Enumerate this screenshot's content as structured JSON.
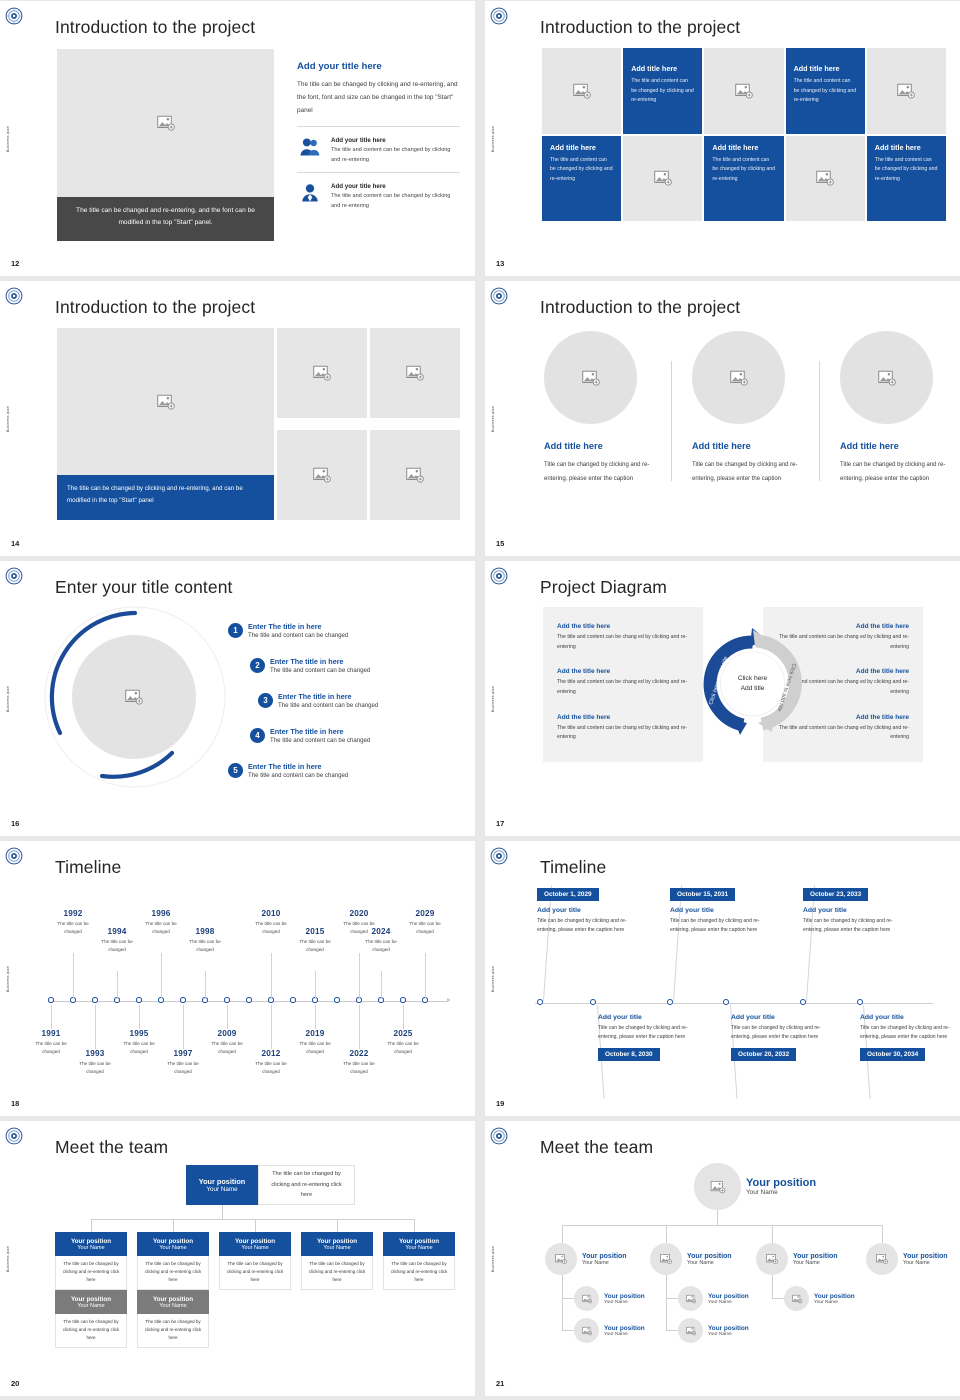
{
  "brand": {
    "accent": "#14509e",
    "dark_caption": "#484848",
    "gray_box": "#e6e6e6",
    "gray_node": "#7b7b7b"
  },
  "sidebar_label": "Business plan",
  "logo_icon": "circular-emblem-logo",
  "slides": [
    {
      "number": "12",
      "title": "Introduction to the project",
      "image_caption": "The title can be changed and re-entering, and the font can be modified in the top \"Start\" panel.",
      "heading": "Add your title here",
      "paragraph": "The title can be changed by clicking and re-entering, and the font, font and size can be changed in the top \"Start\" panel",
      "features": [
        {
          "icon": "people-group-icon",
          "title": "Add your title here",
          "text": "The title and content can be changed by clicking and re-entering"
        },
        {
          "icon": "person-single-icon",
          "title": "Add your title here",
          "text": "The title and content can be changed by clicking and re-entering"
        }
      ]
    },
    {
      "number": "13",
      "title": "Introduction to the project",
      "cells": [
        {
          "type": "image",
          "icon": "image-placeholder-icon"
        },
        {
          "type": "text",
          "title": "Add title here",
          "text": "The title and content can be changed by clicking and re-entering"
        },
        {
          "type": "image",
          "icon": "image-placeholder-icon"
        },
        {
          "type": "text",
          "title": "Add title here",
          "text": "The title and content can be changed by clicking and re-entering"
        },
        {
          "type": "image",
          "icon": "image-placeholder-icon"
        },
        {
          "type": "text",
          "title": "Add title here",
          "text": "The title and content can be changed by clicking and re-entering"
        },
        {
          "type": "image",
          "icon": "image-placeholder-icon"
        },
        {
          "type": "text",
          "title": "Add title here",
          "text": "The title and content can be changed by clicking and re-entering"
        },
        {
          "type": "image",
          "icon": "image-placeholder-icon"
        },
        {
          "type": "text",
          "title": "Add title here",
          "text": "The title and content can be changed by clicking and re-entering"
        }
      ]
    },
    {
      "number": "14",
      "title": "Introduction to the project",
      "image_caption": "The title can be changed by clicking and re-entering, and can be modified in the top \"Start\" panel",
      "quad_icon": "image-placeholder-icon"
    },
    {
      "number": "15",
      "title": "Introduction to the project",
      "columns": [
        {
          "icon": "image-placeholder-icon",
          "title": "Add title here",
          "text": "Title can be changed by clicking and re-entering, please enter the caption"
        },
        {
          "icon": "image-placeholder-icon",
          "title": "Add title here",
          "text": "Title can be changed by clicking and re-entering, please enter the caption"
        },
        {
          "icon": "image-placeholder-icon",
          "title": "Add title here",
          "text": "Title can be changed by clicking and re-entering, please enter the caption"
        }
      ]
    },
    {
      "number": "16",
      "title": "Enter your title content",
      "center_icon": "image-placeholder-icon",
      "items": [
        {
          "num": "1",
          "title": "Enter The title in here",
          "text": "The title and content can be changed"
        },
        {
          "num": "2",
          "title": "Enter The title in here",
          "text": "The title and content can be changed"
        },
        {
          "num": "3",
          "title": "Enter The title in here",
          "text": "The title and content can be changed"
        },
        {
          "num": "4",
          "title": "Enter The title in here",
          "text": "The title and content can be changed"
        },
        {
          "num": "5",
          "title": "Enter The title in here",
          "text": "The title and content can be changed"
        }
      ]
    },
    {
      "number": "17",
      "title": "Project Diagram",
      "hub_line1": "Click here",
      "hub_line2": "Add title",
      "ring_label_left": "Click here to add title",
      "ring_label_right": "Click here to add title",
      "left_items": [
        {
          "title": "Add the title here",
          "text": "The title and content can be chang ed by clicking and re-entering"
        },
        {
          "title": "Add the title here",
          "text": "The title and content can be chang ed by clicking and re-entering"
        },
        {
          "title": "Add the title here",
          "text": "The title and content can be chang ed by clicking and re-entering"
        }
      ],
      "right_items": [
        {
          "title": "Add the title here",
          "text": "The title and content can be chang ed by clicking and re-entering"
        },
        {
          "title": "Add the title here",
          "text": "The title and content can be chang ed by clicking and re-entering"
        },
        {
          "title": "Add the title here",
          "text": "The title and content can be chang ed by clicking and re-entering"
        }
      ]
    },
    {
      "number": "18",
      "title": "Timeline",
      "desc": "The title can be changed",
      "points": [
        {
          "year": "1991",
          "side": "below"
        },
        {
          "year": "1992",
          "side": "above"
        },
        {
          "year": "1993",
          "side": "below"
        },
        {
          "year": "1994",
          "side": "above"
        },
        {
          "year": "1995",
          "side": "below"
        },
        {
          "year": "1996",
          "side": "above"
        },
        {
          "year": "1997",
          "side": "below"
        },
        {
          "year": "1998",
          "side": "above"
        },
        {
          "year": "2009",
          "side": "below"
        },
        {
          "year": "2010",
          "side": "above"
        },
        {
          "year": "2012",
          "side": "below"
        },
        {
          "year": "2015",
          "side": "above"
        },
        {
          "year": "2019",
          "side": "below"
        },
        {
          "year": "2020",
          "side": "above"
        },
        {
          "year": "2022",
          "side": "below"
        },
        {
          "year": "2024",
          "side": "above"
        },
        {
          "year": "2025",
          "side": "below"
        },
        {
          "year": "2029",
          "side": "above"
        }
      ]
    },
    {
      "number": "19",
      "title": "Timeline",
      "cards": [
        {
          "date": "October 1, 2029",
          "title": "Add your title",
          "text": "Title can be changed by clicking and re-entering, please enter the caption here",
          "side": "above"
        },
        {
          "date": "October 8, 2030",
          "title": "Add your title",
          "text": "Title can be changed by clicking and re-entering, please enter the caption here",
          "side": "below"
        },
        {
          "date": "October 15, 2031",
          "title": "Add your title",
          "text": "Title can be changed by clicking and re-entering, please enter the caption here",
          "side": "above"
        },
        {
          "date": "October 20, 2032",
          "title": "Add your title",
          "text": "Title can be changed by clicking and re-entering, please enter the caption here",
          "side": "below"
        },
        {
          "date": "October 23, 2033",
          "title": "Add your title",
          "text": "Title can be changed by clicking and re-entering, please enter the caption here",
          "side": "above"
        },
        {
          "date": "October 30, 2034",
          "title": "Add your title",
          "text": "Title can be changed by clicking and re-entering, please enter the caption here",
          "side": "below"
        }
      ]
    },
    {
      "number": "20",
      "title": "Meet the team",
      "root": {
        "position": "Your position",
        "name": "Your Name",
        "note": "The title can be changed by clicking and re-entering click here"
      },
      "level1": [
        {
          "position": "Your position",
          "name": "Your Name",
          "text": "The title can be changed by clicking and re-entering click here",
          "color": "blue"
        },
        {
          "position": "Your position",
          "name": "Your Name",
          "text": "The title can be changed by clicking and re-entering click here",
          "color": "blue"
        },
        {
          "position": "Your position",
          "name": "Your Name",
          "text": "The title can be changed by clicking and re-entering click here",
          "color": "blue"
        },
        {
          "position": "Your position",
          "name": "Your Name",
          "text": "The title can be changed by clicking and re-entering click here",
          "color": "blue"
        },
        {
          "position": "Your position",
          "name": "Your Name",
          "text": "The title can be changed by clicking and re-entering click here",
          "color": "blue"
        }
      ],
      "level2": [
        {
          "position": "Your position",
          "name": "Your Name",
          "text": "The title can be changed by clicking and re-entering click here",
          "color": "gray"
        },
        {
          "position": "Your position",
          "name": "Your Name",
          "text": "The title can be changed by clicking and re-entering click here",
          "color": "gray"
        }
      ]
    },
    {
      "number": "21",
      "title": "Meet the team",
      "root": {
        "position": "Your position",
        "name": "Your Name",
        "icon": "image-placeholder-icon"
      },
      "level1": [
        {
          "position": "Your position",
          "name": "Your Name",
          "icon": "image-placeholder-icon"
        },
        {
          "position": "Your position",
          "name": "Your Name",
          "icon": "image-placeholder-icon"
        },
        {
          "position": "Your position",
          "name": "Your Name",
          "icon": "image-placeholder-icon"
        },
        {
          "position": "Your position",
          "name": "Your Name",
          "icon": "image-placeholder-icon"
        }
      ],
      "level2": [
        {
          "position": "Your position",
          "name": "Your Name",
          "icon": "image-placeholder-icon"
        },
        {
          "position": "Your position",
          "name": "Your Name",
          "icon": "image-placeholder-icon"
        },
        {
          "position": "Your position",
          "name": "Your Name",
          "icon": "image-placeholder-icon"
        },
        {
          "position": "Your position",
          "name": "Your Name",
          "icon": "image-placeholder-icon"
        },
        {
          "position": "Your position",
          "name": "Your Name",
          "icon": "image-placeholder-icon"
        }
      ]
    }
  ]
}
